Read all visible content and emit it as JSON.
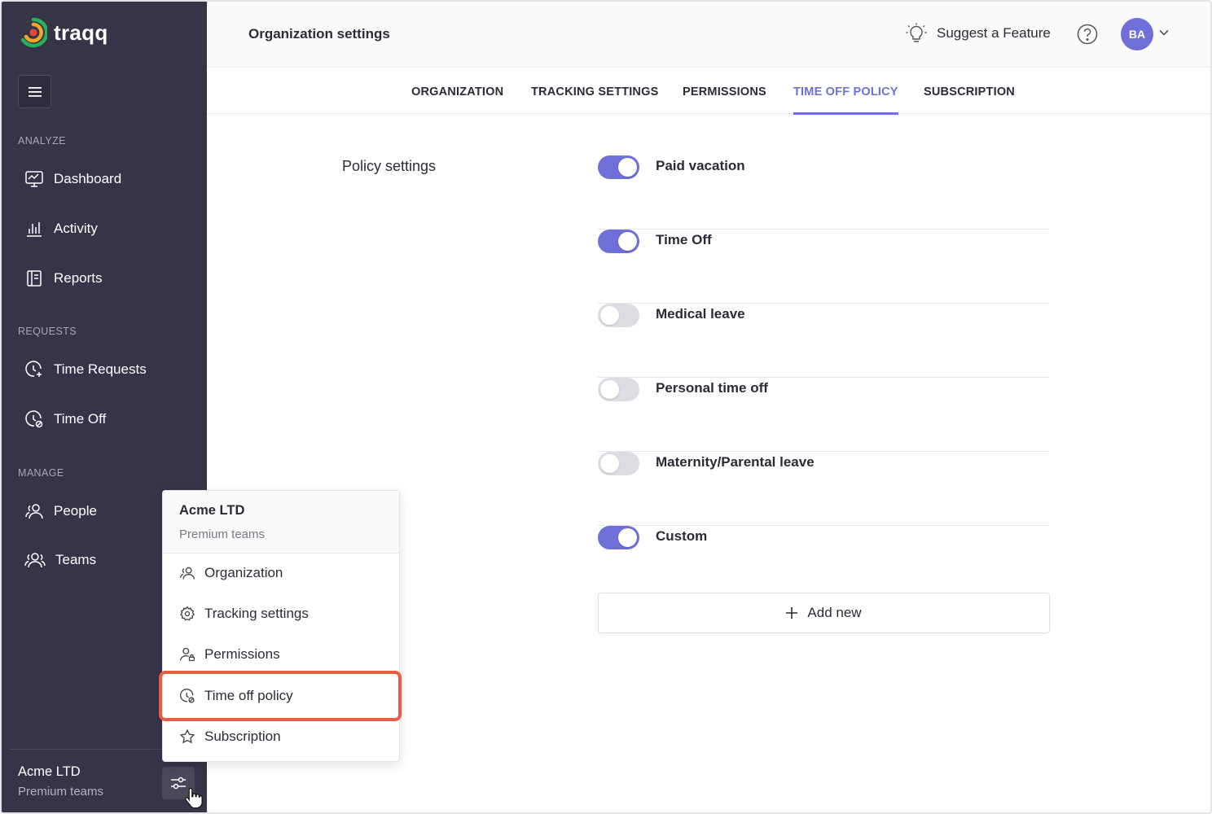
{
  "app": {
    "name": "traqq"
  },
  "sidebar": {
    "sections": [
      {
        "label": "ANALYZE",
        "items": [
          {
            "label": "Dashboard",
            "icon": "dashboard-icon"
          },
          {
            "label": "Activity",
            "icon": "bar-chart-icon"
          },
          {
            "label": "Reports",
            "icon": "reports-icon"
          }
        ]
      },
      {
        "label": "REQUESTS",
        "items": [
          {
            "label": "Time Requests",
            "icon": "clock-plus-icon"
          },
          {
            "label": "Time Off",
            "icon": "clock-off-icon"
          }
        ]
      },
      {
        "label": "MANAGE",
        "items": [
          {
            "label": "People",
            "icon": "people-icon"
          },
          {
            "label": "Teams",
            "icon": "teams-icon"
          }
        ]
      }
    ],
    "footer": {
      "org": "Acme LTD",
      "plan": "Premium teams"
    }
  },
  "header": {
    "title": "Organization settings",
    "suggest_label": "Suggest a Feature",
    "avatar_initials": "BA"
  },
  "tabs": [
    {
      "label": "ORGANIZATION",
      "active": false
    },
    {
      "label": "TRACKING SETTINGS",
      "active": false
    },
    {
      "label": "PERMISSIONS",
      "active": false
    },
    {
      "label": "TIME OFF POLICY",
      "active": true
    },
    {
      "label": "SUBSCRIPTION",
      "active": false
    }
  ],
  "policy": {
    "heading": "Policy settings",
    "items": [
      {
        "label": "Paid vacation",
        "enabled": true
      },
      {
        "label": "Time Off",
        "enabled": true
      },
      {
        "label": "Medical leave",
        "enabled": false
      },
      {
        "label": "Personal time off",
        "enabled": false
      },
      {
        "label": "Maternity/Parental leave",
        "enabled": false
      },
      {
        "label": "Custom",
        "enabled": true
      }
    ],
    "add_label": "Add new"
  },
  "popup": {
    "org": "Acme LTD",
    "plan": "Premium teams",
    "items": [
      {
        "label": "Organization",
        "icon": "people-icon"
      },
      {
        "label": "Tracking settings",
        "icon": "gear-icon"
      },
      {
        "label": "Permissions",
        "icon": "user-lock-icon"
      },
      {
        "label": "Time off policy",
        "icon": "clock-off-icon",
        "highlighted": true
      },
      {
        "label": "Subscription",
        "icon": "star-icon"
      }
    ]
  },
  "colors": {
    "accent": "#6f6fd8",
    "sidebar_bg": "#363447",
    "highlight": "#ec5b45"
  }
}
